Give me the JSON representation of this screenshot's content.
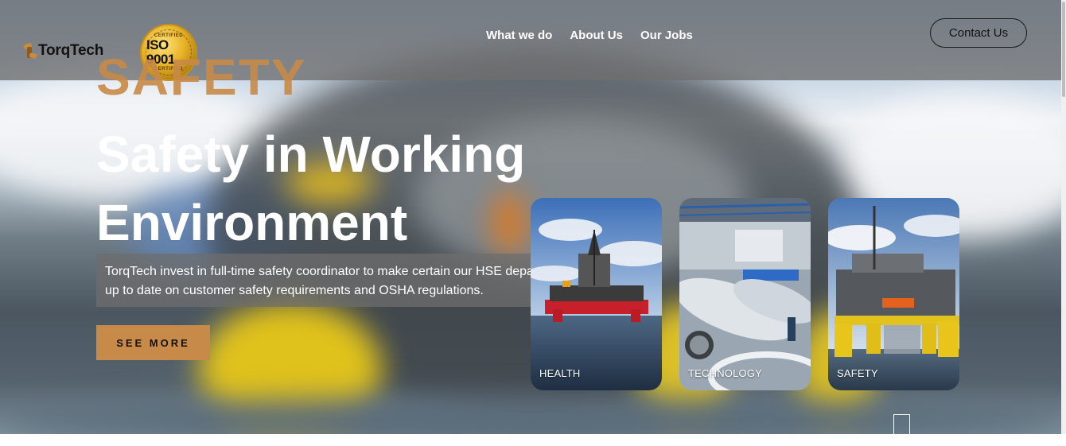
{
  "brand": {
    "name": "TorqTech",
    "badge": {
      "top": "CERTIFIED",
      "main": "ISO 9001",
      "bottom": "CERTIFIED"
    }
  },
  "nav": {
    "items": [
      {
        "label": "What we do"
      },
      {
        "label": "About Us"
      },
      {
        "label": "Our Jobs"
      }
    ]
  },
  "header": {
    "contact_label": "Contact Us"
  },
  "hero": {
    "eyebrow": "SAFETY",
    "headline_line1": "Safety in Working",
    "headline_line2": "Environment",
    "description_line1": "TorqTech invest in full-time safety coordinator to make certain our HSE department is",
    "description_line2": "up to date on customer safety requirements and OSHA regulations.",
    "cta_label": "SEE MORE"
  },
  "cards": [
    {
      "label": "HEALTH",
      "image": "offshore-rig-at-sea"
    },
    {
      "label": "TECHNOLOGY",
      "image": "factory-pipes"
    },
    {
      "label": "SAFETY",
      "image": "platform-yellow-legs"
    }
  ],
  "colors": {
    "accent": "#c88a48",
    "header_overlay": "#6e6e6e",
    "text_light": "#ffffff"
  }
}
